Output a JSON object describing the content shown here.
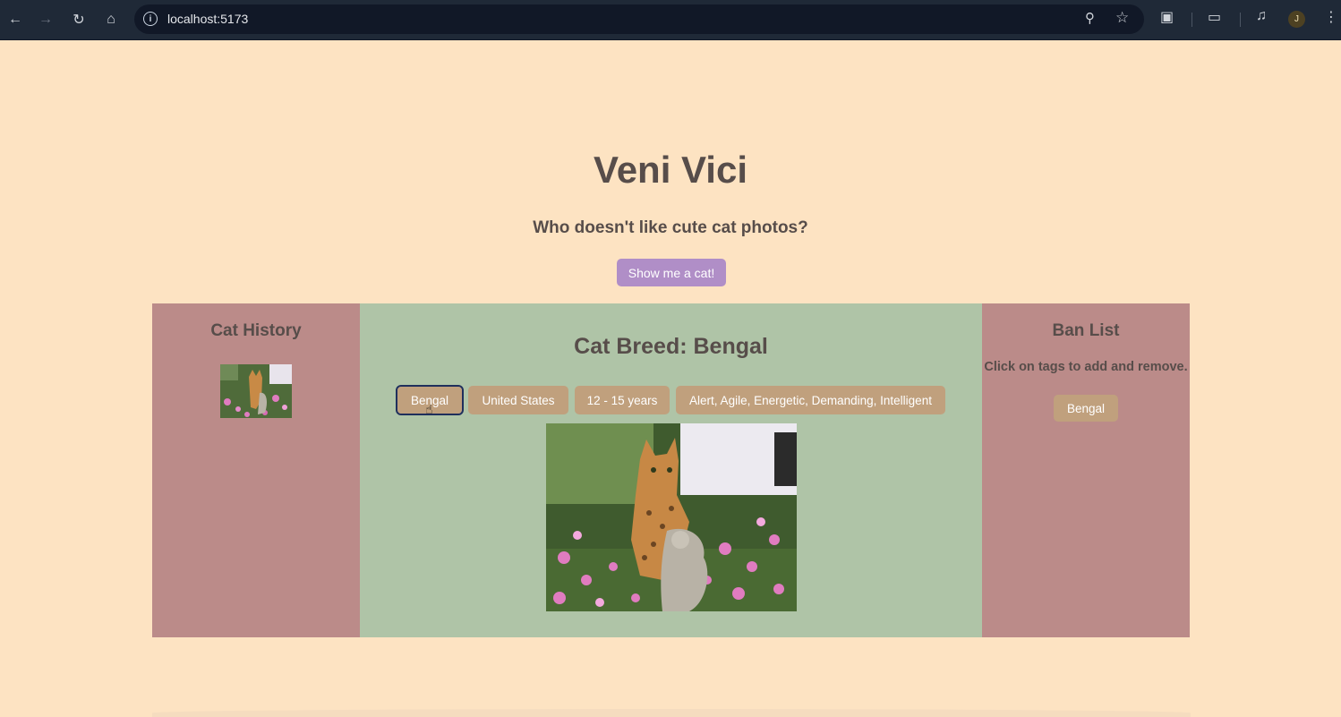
{
  "browser": {
    "url": "localhost:5173",
    "avatar_initial": "J"
  },
  "page": {
    "title": "Veni Vici",
    "subtitle": "Who doesn't like cute cat photos?",
    "show_button_label": "Show me a cat!"
  },
  "history": {
    "heading": "Cat History"
  },
  "main": {
    "heading": "Cat Breed: Bengal",
    "tags": [
      "Bengal",
      "United States",
      "12 - 15 years",
      "Alert, Agile, Energetic, Demanding, Intelligent"
    ]
  },
  "ban": {
    "heading": "Ban List",
    "instructions": "Click on tags to add and remove.",
    "items": [
      "Bengal"
    ]
  },
  "colors": {
    "page_bg": "#fde3c2",
    "side_panel": "#bb8b89",
    "main_panel": "#afc4a7",
    "tag": "#c0a07d",
    "show_button": "#b08ec7",
    "text": "#574d4a"
  }
}
